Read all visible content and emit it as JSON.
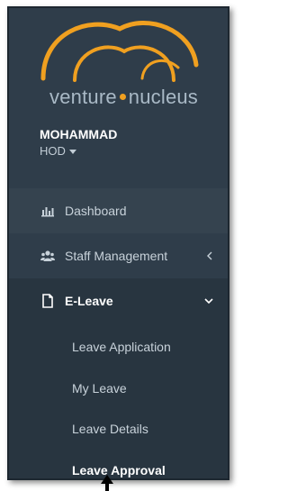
{
  "brand": {
    "logo_word1": "venture",
    "logo_word2": "nucleus"
  },
  "user": {
    "name": "MOHAMMAD",
    "role": "HOD"
  },
  "menu": {
    "items": [
      {
        "label": "Dashboard",
        "icon": "bar-chart-icon"
      },
      {
        "label": "Staff Management",
        "icon": "users-icon",
        "indicator": "chevron-left-icon"
      },
      {
        "label": "E-Leave",
        "icon": "document-icon",
        "indicator": "chevron-down-icon"
      }
    ],
    "eleave_sub": [
      {
        "label": "Leave Application"
      },
      {
        "label": "My Leave"
      },
      {
        "label": "Leave Details"
      },
      {
        "label": "Leave Approval",
        "active": true
      }
    ]
  },
  "colors": {
    "sidebar_bg": "#2f3d4a",
    "active_bg": "#283540",
    "logo_orange": "#f0a020",
    "logo_text": "#a9b9c6"
  }
}
